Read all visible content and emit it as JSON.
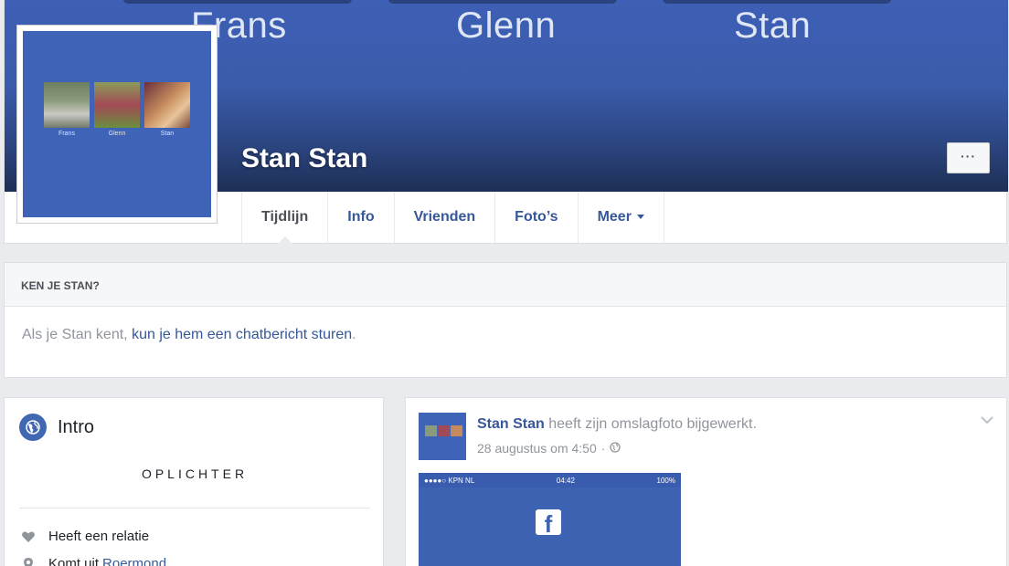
{
  "cover": {
    "names": [
      "Frans",
      "Glenn",
      "Stan"
    ],
    "profile_name": "Stan Stan",
    "more_label": "···"
  },
  "avatar": {
    "labels": [
      "Frans",
      "Glenn",
      "Stan"
    ]
  },
  "tabs": [
    {
      "label": "Tijdlijn",
      "active": true
    },
    {
      "label": "Info"
    },
    {
      "label": "Vrienden"
    },
    {
      "label": "Foto’s"
    },
    {
      "label": "Meer"
    }
  ],
  "know": {
    "heading": "KEN JE STAN?",
    "text_prefix": "Als je Stan kent,",
    "link_text": "kun je hem een chatbericht sturen",
    "text_suffix": "."
  },
  "intro": {
    "title": "Intro",
    "bio": "OPLICHTER",
    "relationship": "Heeft een relatie",
    "from_prefix": "Komt uit",
    "from_place": "Roermond"
  },
  "post": {
    "author": "Stan Stan",
    "action": "heeft zijn omslagfoto bijgewerkt.",
    "timestamp": "28 augustus om 4:50",
    "meta_sep": "·",
    "image_status": {
      "carrier": "●●●●○ KPN NL",
      "time": "04:42",
      "battery": "100%"
    },
    "fb_logo": "f"
  }
}
